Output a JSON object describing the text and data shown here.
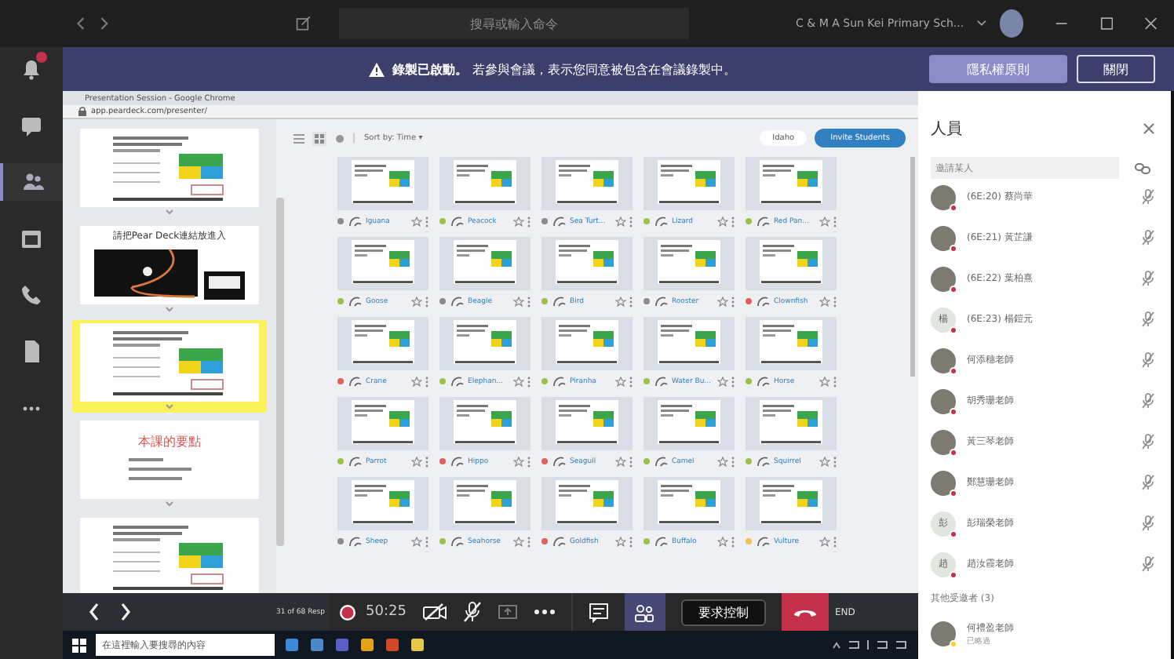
{
  "top_bar": {
    "search": {
      "placeholder": "搜尋或輸入命令"
    },
    "organization": "C & M A Sun Kei Primary Sch..."
  },
  "rail": {
    "items": [
      {
        "kind": "bell",
        "badge": true,
        "selected": false
      },
      {
        "kind": "chat",
        "badge": false,
        "selected": false
      },
      {
        "kind": "teams",
        "badge": false,
        "selected": true
      },
      {
        "kind": "calendar",
        "badge": false,
        "selected": false
      },
      {
        "kind": "calls",
        "badge": false,
        "selected": false
      },
      {
        "kind": "files",
        "badge": false,
        "selected": false
      },
      {
        "kind": "more",
        "badge": false,
        "selected": false
      }
    ]
  },
  "banner": {
    "message": "**錄製已啟動。** 若參與會議，表示您同意被包含在會議錄製中。",
    "buttons": [
      {
        "label": "隱私權原則",
        "kind": "primary"
      },
      {
        "label": "關閉",
        "kind": "outline"
      }
    ]
  },
  "browser": {
    "title": "Presentation Session - Google Chrome",
    "url": "app.peardeck.com/presenter/"
  },
  "slides": [
    {
      "kind": "form",
      "selected": false
    },
    {
      "kind": "video",
      "title": "請把Pear Deck連結放進入",
      "selected": false
    },
    {
      "kind": "form",
      "selected": true
    },
    {
      "kind": "list",
      "title": "本課的要點",
      "selected": false
    },
    {
      "kind": "form",
      "selected": false
    }
  ],
  "dashboard": {
    "sort": "Sort by: Time ▾",
    "hide_button": "Idaho",
    "invite_button": "Invite Students",
    "students": [
      {
        "name": "Iguana",
        "color": "#8a8a8a"
      },
      {
        "name": "Peacock",
        "color": "#9ac24a"
      },
      {
        "name": "Sea Turt...",
        "color": "#8a8a8a"
      },
      {
        "name": "Lizard",
        "color": "#9ac24a"
      },
      {
        "name": "Red Pan...",
        "color": "#9ac24a"
      },
      {
        "name": "Goose",
        "color": "#9ac24a"
      },
      {
        "name": "Beagle",
        "color": "#8a8a8a"
      },
      {
        "name": "Bird",
        "color": "#9ac24a"
      },
      {
        "name": "Rooster",
        "color": "#8a8a8a"
      },
      {
        "name": "Clownfish",
        "color": "#e0605a"
      },
      {
        "name": "Crane",
        "color": "#e0605a"
      },
      {
        "name": "Elephan...",
        "color": "#9ac24a"
      },
      {
        "name": "Piranha",
        "color": "#9ac24a"
      },
      {
        "name": "Water Bu...",
        "color": "#9ac24a"
      },
      {
        "name": "Horse",
        "color": "#9ac24a"
      },
      {
        "name": "Parrot",
        "color": "#9ac24a"
      },
      {
        "name": "Hippo",
        "color": "#e0605a"
      },
      {
        "name": "Seagull",
        "color": "#e0605a"
      },
      {
        "name": "Camel",
        "color": "#9ac24a"
      },
      {
        "name": "Squirrel",
        "color": "#9ac24a"
      },
      {
        "name": "Sheep",
        "color": "#8a8a8a"
      },
      {
        "name": "Seahorse",
        "color": "#9ac24a"
      },
      {
        "name": "Goldfish",
        "color": "#e0605a"
      },
      {
        "name": "Buffalo",
        "color": "#9ac24a"
      },
      {
        "name": "Vulture",
        "color": "#f2c14e"
      }
    ]
  },
  "bottom_bar": {
    "responses": "31 of 68 Resp",
    "timer": "50:25",
    "request_control": "要求控制",
    "end": "END"
  },
  "taskbar": {
    "search": {
      "placeholder": "在這裡輸入要搜尋的內容"
    }
  },
  "people_panel": {
    "title": "人員",
    "invite": {
      "placeholder": "邀請某人"
    },
    "people": [
      {
        "name": "(6E:20) 蔡尚華",
        "color": "#c4314b",
        "muted": true
      },
      {
        "name": "(6E:21) 黃芷謙",
        "color": "#c4314b",
        "muted": true
      },
      {
        "name": "(6E:22) 葉柏熹",
        "color": "#c4314b",
        "muted": true
      },
      {
        "name": "(6E:23) 楊鎧元",
        "initial": "楊",
        "color": "#c4314b",
        "muted": true
      },
      {
        "name": "何添穗老師",
        "color": "#c4314b",
        "muted": true
      },
      {
        "name": "胡秀珊老師",
        "color": "#c4314b",
        "muted": true
      },
      {
        "name": "黃三琴老師",
        "color": "#c4314b",
        "muted": true
      },
      {
        "name": "鄭慧珊老師",
        "color": "#c4314b",
        "muted": true
      },
      {
        "name": "彭瑞榮老師",
        "initial": "彭",
        "color": "#c4314b",
        "muted": true
      },
      {
        "name": "趙汝霞老師",
        "initial": "趙",
        "color": "#c4314b",
        "muted": true
      }
    ],
    "others_header": "其他受邀者 (3)",
    "others": [
      {
        "name": "何禮盈老師",
        "status": "已略過",
        "color": "#f8d22a",
        "muted": false
      }
    ]
  }
}
